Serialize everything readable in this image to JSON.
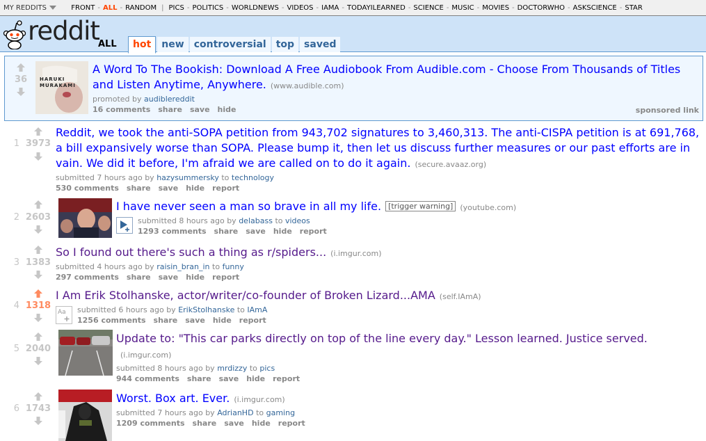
{
  "srbar": {
    "myreddits": "MY REDDITS",
    "front": "FRONT",
    "all": "ALL",
    "random": "RANDOM",
    "subreddits": [
      "PICS",
      "POLITICS",
      "WORLDNEWS",
      "VIDEOS",
      "IAMA",
      "TODAYILEARNED",
      "SCIENCE",
      "MUSIC",
      "MOVIES",
      "DOCTORWHO",
      "ASKSCIENCE",
      "STAR"
    ]
  },
  "header": {
    "logo": "reddit",
    "subreddit": "ALL",
    "tabs": [
      "hot",
      "new",
      "controversial",
      "top",
      "saved"
    ],
    "selected_tab": "hot"
  },
  "promoted": {
    "score": "36",
    "title": "A Word To The Bookish: Download A Free Audiobook From Audible.com - Choose From Thousands of Titles and Listen Anytime, Anywhere.",
    "domain": "(www.audible.com)",
    "tagline_prefix": "promoted by",
    "author": "audiblereddit",
    "comments": "16 comments",
    "share": "share",
    "save": "save",
    "hide": "hide",
    "sponsored": "sponsored link",
    "thumb_text": "HARUKI MURAKAMI"
  },
  "posts": [
    {
      "rank": "1",
      "score": "3973",
      "title": "Reddit, we took the anti-SOPA petition from 943,702 signatures to 3,460,313. The anti-CISPA petition is at 691,768, a bill expansively worse than SOPA. Please bump it, then let us discuss further measures or our past efforts are in vain. We did it before, I'm afraid we are called on to do it again.",
      "domain": "(secure.avaaz.org)",
      "submitted": "submitted 7 hours ago by",
      "author": "hazysummersky",
      "to": "to",
      "subreddit": "technology",
      "comments": "530 comments"
    },
    {
      "rank": "2",
      "score": "2603",
      "title": "I have never seen a man so brave in all my life.",
      "flair": "[trigger warning]",
      "domain": "(youtube.com)",
      "submitted": "submitted 8 hours ago by",
      "author": "delabass",
      "to": "to",
      "subreddit": "videos",
      "comments": "1293 comments"
    },
    {
      "rank": "3",
      "score": "1383",
      "title": "So I found out there's such a thing as r/spiders...",
      "domain": "(i.imgur.com)",
      "submitted": "submitted 4 hours ago by",
      "author": "raisin_bran_in",
      "to": "to",
      "subreddit": "funny",
      "comments": "297 comments"
    },
    {
      "rank": "4",
      "score": "1318",
      "title": "I Am Erik Stolhanske, actor/writer/co-founder of Broken Lizard...AMA",
      "domain": "(self.IAmA)",
      "submitted": "submitted 6 hours ago by",
      "author": "ErikStolhanske",
      "to": "to",
      "subreddit": "IAmA",
      "comments": "1256 comments"
    },
    {
      "rank": "5",
      "score": "2040",
      "title": "Update to: \"This car parks directly on top of the line every day.\" Lesson learned. Justice served.",
      "domain": "(i.imgur.com)",
      "submitted": "submitted 8 hours ago by",
      "author": "mrdizzy",
      "to": "to",
      "subreddit": "pics",
      "comments": "944 comments"
    },
    {
      "rank": "6",
      "score": "1743",
      "title": "Worst. Box art. Ever.",
      "domain": "(i.imgur.com)",
      "submitted": "submitted 7 hours ago by",
      "author": "AdrianHD",
      "to": "to",
      "subreddit": "gaming",
      "comments": "1209 comments"
    }
  ],
  "buttons": {
    "share": "share",
    "save": "save",
    "hide": "hide",
    "report": "report"
  },
  "colors": {
    "header_bg": "#cee3f8",
    "link": "#0000ff",
    "visited": "#551a8b",
    "orangered": "#ff4500",
    "upvoted": "#ff8b60"
  }
}
